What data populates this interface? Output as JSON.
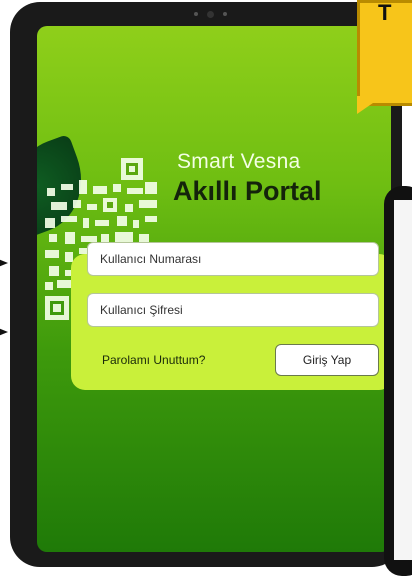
{
  "brand": {
    "subtitle": "Smart Vesna",
    "title": "Akıllı Portal"
  },
  "login": {
    "username_placeholder": "Kullanıcı Numarası",
    "password_placeholder": "Kullanıcı Şifresi",
    "forgot_password": "Parolamı Unuttum?",
    "submit": "Giriş Yap"
  },
  "colors": {
    "screen_top": "#8fcf1a",
    "screen_bottom": "#1f7a08",
    "card": "#c9f03a",
    "bubble": "#f7c51a"
  },
  "icons": {
    "leaf": "leaf-decoration",
    "qr": "qr-code-graphic",
    "pointer": "pointer-arrow-icon"
  }
}
